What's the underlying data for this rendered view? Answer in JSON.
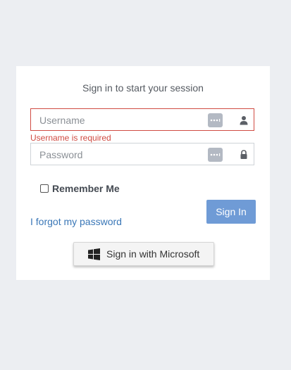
{
  "header": {
    "title": "Sign in to start your session"
  },
  "username": {
    "placeholder": "Username",
    "error": "Username is required"
  },
  "password": {
    "placeholder": "Password"
  },
  "remember": {
    "label": "Remember Me",
    "checked": false
  },
  "forgot": {
    "label": "I forgot my password"
  },
  "signin": {
    "label": "Sign In"
  },
  "microsoft": {
    "label": "Sign in with Microsoft"
  },
  "icons": {
    "password_manager": "password-manager-icon",
    "user": "user-icon",
    "lock": "lock-icon",
    "windows": "windows-logo-icon"
  },
  "colors": {
    "accent": "#6f9bd6",
    "error": "#d04b42",
    "link": "#3a77b7",
    "background": "#eceef2"
  }
}
